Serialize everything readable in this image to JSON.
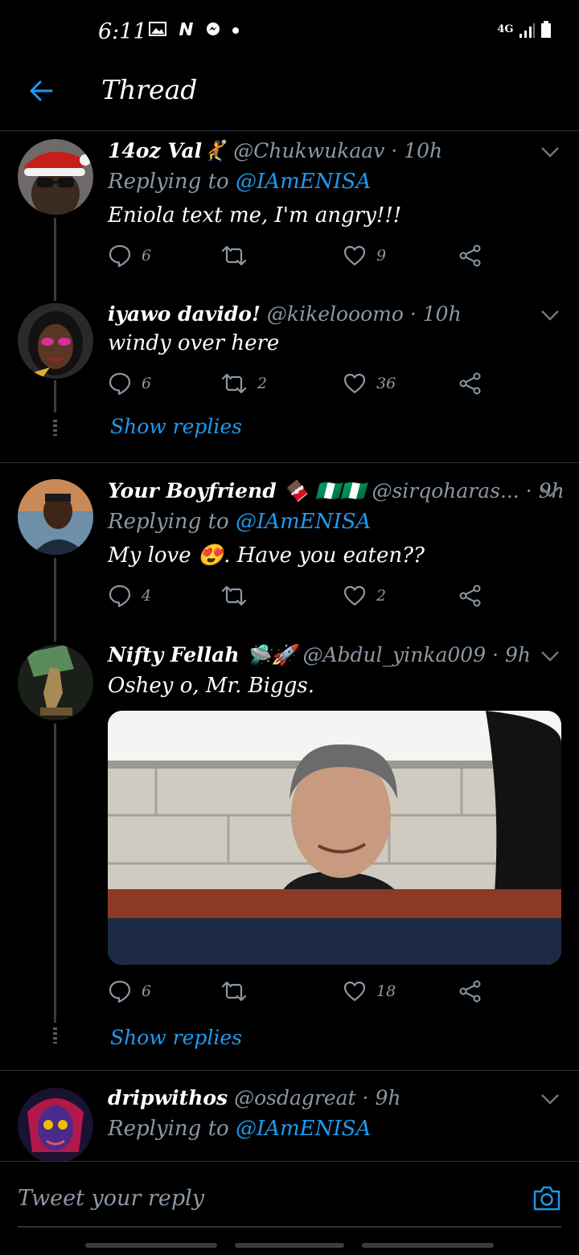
{
  "status_bar": {
    "time": "6:11",
    "icons": [
      "image-icon",
      "n-icon",
      "messenger-icon",
      "dot-icon"
    ],
    "network": "4G",
    "battery_icon": "battery-icon"
  },
  "header": {
    "title": "Thread",
    "back_icon": "back-arrow-icon"
  },
  "tweets": [
    {
      "name": "14oz Val🤾",
      "handle": "@Chukwukaav",
      "time": "10h",
      "replying_prefix": "Replying to",
      "replying_to": "@IAmENISA",
      "text": "Eniola text me, I'm angry!!!",
      "replies": "6",
      "retweets": "",
      "likes": "9"
    },
    {
      "name": "iyawo davido!",
      "handle": "@kikelooomo",
      "time": "10h",
      "text": "windy over here",
      "replies": "6",
      "retweets": "2",
      "likes": "36",
      "show_replies": "Show replies"
    },
    {
      "name": "Your Boyfriend 🍫 🇳🇬🇳🇬",
      "handle": "@sirqoharas...",
      "time": "9h",
      "replying_prefix": "Replying to",
      "replying_to": "@IAmENISA",
      "text": "My love 😍. Have you eaten??",
      "replies": "4",
      "retweets": "",
      "likes": "2"
    },
    {
      "name": "Nifty Fellah 🛸🚀",
      "handle": "@Abdul_yinka009",
      "time": "9h",
      "text": "Oshey o, Mr. Biggs.",
      "replies": "6",
      "retweets": "",
      "likes": "18",
      "show_replies": "Show replies"
    },
    {
      "name": "dripwithos",
      "handle": "@osdagreat",
      "time": "9h",
      "replying_prefix": "Replying to",
      "replying_to": "@IAmENISA"
    }
  ],
  "composer": {
    "placeholder": "Tweet your reply"
  },
  "colors": {
    "accent": "#1d9bf0",
    "muted": "#8b98a5",
    "background": "#000000"
  }
}
